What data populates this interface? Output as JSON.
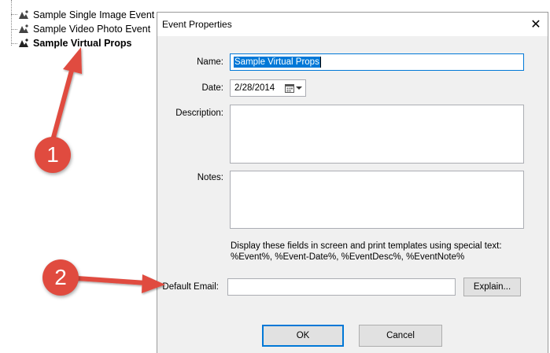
{
  "tree": {
    "items": [
      {
        "label": "Sample Single Image Event",
        "bold": false
      },
      {
        "label": "Sample Video Photo Event",
        "bold": false
      },
      {
        "label": "Sample Virtual Props",
        "bold": true
      }
    ]
  },
  "dialog": {
    "title": "Event Properties",
    "close_symbol": "✕",
    "name_label": "Name:",
    "name_value": "Sample Virtual Props",
    "date_label": "Date:",
    "date_value": "2/28/2014",
    "description_label": "Description:",
    "description_value": "",
    "notes_label": "Notes:",
    "notes_value": "",
    "hint_line1": "Display these fields in screen and print templates using special text:",
    "hint_line2": "%Event%, %Event-Date%, %EventDesc%, %EventNote%",
    "email_label": "Default Email:",
    "email_value": "",
    "explain_label": "Explain...",
    "ok_label": "OK",
    "cancel_label": "Cancel"
  },
  "annotations": {
    "badge1": "1",
    "badge2": "2",
    "color": "#e04b3f"
  },
  "icons": {
    "tree_item_icon": "event-props-icon",
    "calendar_icon": "calendar-icon",
    "dropdown_icon": "chevron-down-icon"
  }
}
